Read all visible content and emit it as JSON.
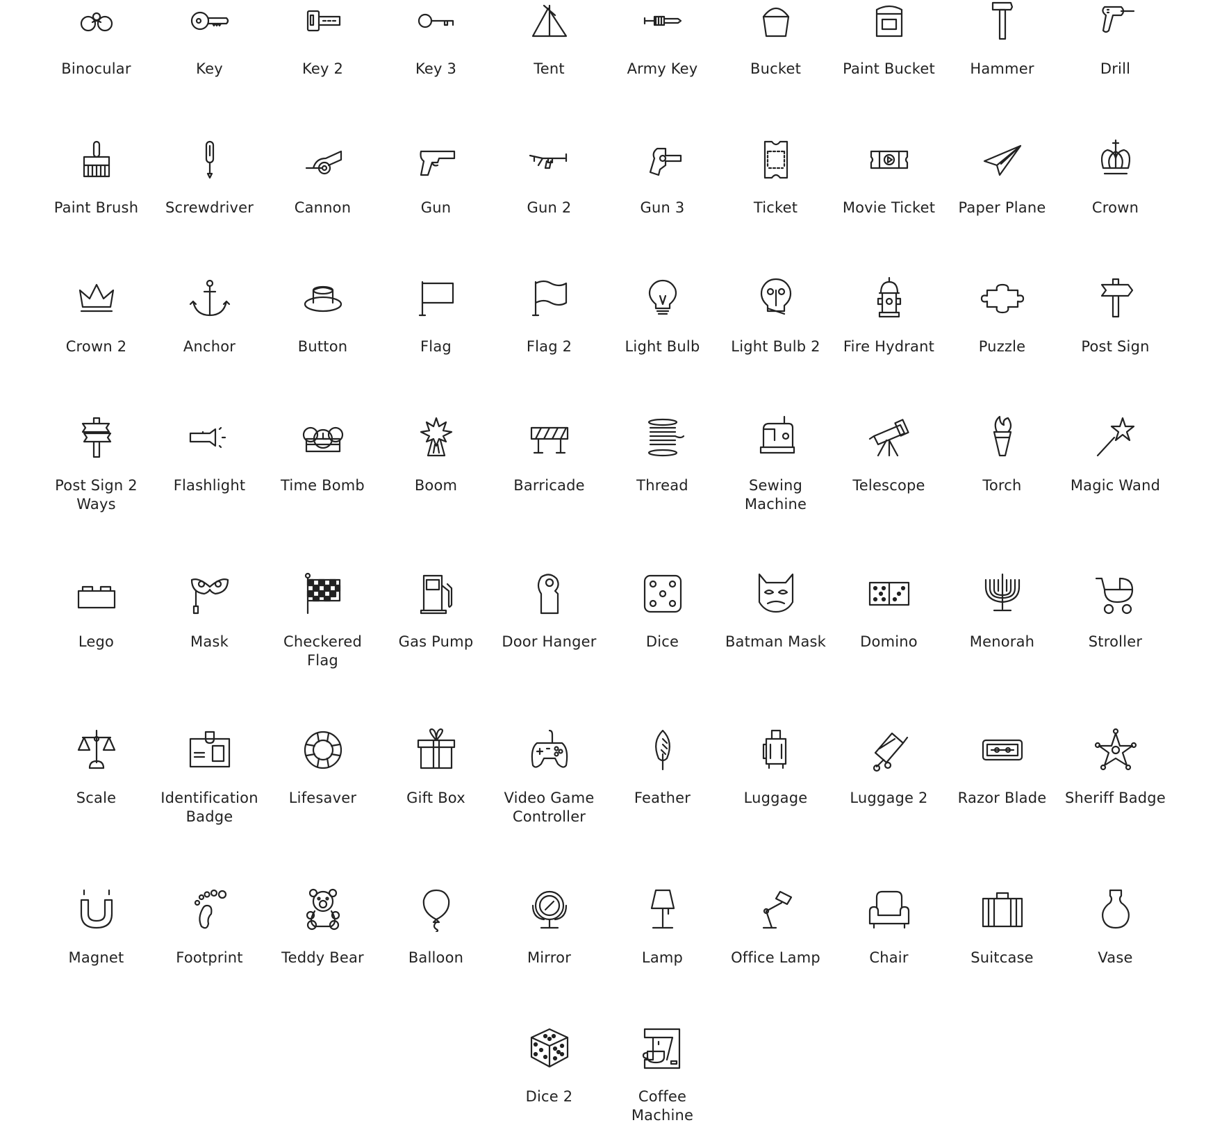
{
  "page": {
    "text_color": "#222222",
    "background": "#ffffff"
  },
  "icons": [
    {
      "name": "Binocular",
      "icon": "binocular-icon"
    },
    {
      "name": "Key",
      "icon": "key-icon"
    },
    {
      "name": "Key 2",
      "icon": "key-2-icon"
    },
    {
      "name": "Key 3",
      "icon": "key-3-icon"
    },
    {
      "name": "Tent",
      "icon": "tent-icon"
    },
    {
      "name": "Army Key",
      "icon": "army-key-icon"
    },
    {
      "name": "Bucket",
      "icon": "bucket-icon"
    },
    {
      "name": "Paint Bucket",
      "icon": "paint-bucket-icon"
    },
    {
      "name": "Hammer",
      "icon": "hammer-icon"
    },
    {
      "name": "Drill",
      "icon": "drill-icon"
    },
    {
      "name": "Paint Brush",
      "icon": "paint-brush-icon"
    },
    {
      "name": "Screwdriver",
      "icon": "screwdriver-icon"
    },
    {
      "name": "Cannon",
      "icon": "cannon-icon"
    },
    {
      "name": "Gun",
      "icon": "gun-icon"
    },
    {
      "name": "Gun 2",
      "icon": "gun-2-icon"
    },
    {
      "name": "Gun 3",
      "icon": "gun-3-icon"
    },
    {
      "name": "Ticket",
      "icon": "ticket-icon"
    },
    {
      "name": "Movie Ticket",
      "icon": "movie-ticket-icon"
    },
    {
      "name": "Paper Plane",
      "icon": "paper-plane-icon"
    },
    {
      "name": "Crown",
      "icon": "crown-icon"
    },
    {
      "name": "Crown 2",
      "icon": "crown-2-icon"
    },
    {
      "name": "Anchor",
      "icon": "anchor-icon"
    },
    {
      "name": "Button",
      "icon": "button-icon"
    },
    {
      "name": "Flag",
      "icon": "flag-icon"
    },
    {
      "name": "Flag 2",
      "icon": "flag-2-icon"
    },
    {
      "name": "Light Bulb",
      "icon": "light-bulb-icon"
    },
    {
      "name": "Light Bulb 2",
      "icon": "light-bulb-2-icon"
    },
    {
      "name": "Fire Hydrant",
      "icon": "fire-hydrant-icon"
    },
    {
      "name": "Puzzle",
      "icon": "puzzle-icon"
    },
    {
      "name": "Post Sign",
      "icon": "post-sign-icon"
    },
    {
      "name": "Post Sign 2 Ways",
      "icon": "post-sign-2-ways-icon"
    },
    {
      "name": "Flashlight",
      "icon": "flashlight-icon"
    },
    {
      "name": "Time Bomb",
      "icon": "time-bomb-icon"
    },
    {
      "name": "Boom",
      "icon": "boom-icon"
    },
    {
      "name": "Barricade",
      "icon": "barricade-icon"
    },
    {
      "name": "Thread",
      "icon": "thread-icon"
    },
    {
      "name": "Sewing Machine",
      "icon": "sewing-machine-icon"
    },
    {
      "name": "Telescope",
      "icon": "telescope-icon"
    },
    {
      "name": "Torch",
      "icon": "torch-icon"
    },
    {
      "name": "Magic Wand",
      "icon": "magic-wand-icon"
    },
    {
      "name": "Lego",
      "icon": "lego-icon"
    },
    {
      "name": "Mask",
      "icon": "mask-icon"
    },
    {
      "name": "Checkered Flag",
      "icon": "checkered-flag-icon"
    },
    {
      "name": "Gas Pump",
      "icon": "gas-pump-icon"
    },
    {
      "name": "Door Hanger",
      "icon": "door-hanger-icon"
    },
    {
      "name": "Dice",
      "icon": "dice-icon"
    },
    {
      "name": "Batman Mask",
      "icon": "batman-mask-icon"
    },
    {
      "name": "Domino",
      "icon": "domino-icon"
    },
    {
      "name": "Menorah",
      "icon": "menorah-icon"
    },
    {
      "name": "Stroller",
      "icon": "stroller-icon"
    },
    {
      "name": "Scale",
      "icon": "scale-icon"
    },
    {
      "name": "Identification Badge",
      "icon": "identification-badge-icon"
    },
    {
      "name": "Lifesaver",
      "icon": "lifesaver-icon"
    },
    {
      "name": "Gift Box",
      "icon": "gift-box-icon"
    },
    {
      "name": "Video Game Controller",
      "icon": "video-game-controller-icon"
    },
    {
      "name": "Feather",
      "icon": "feather-icon"
    },
    {
      "name": "Luggage",
      "icon": "luggage-icon"
    },
    {
      "name": "Luggage 2",
      "icon": "luggage-2-icon"
    },
    {
      "name": "Razor Blade",
      "icon": "razor-blade-icon"
    },
    {
      "name": "Sheriff Badge",
      "icon": "sheriff-badge-icon"
    },
    {
      "name": "Magnet",
      "icon": "magnet-icon"
    },
    {
      "name": "Footprint",
      "icon": "footprint-icon"
    },
    {
      "name": "Teddy Bear",
      "icon": "teddy-bear-icon"
    },
    {
      "name": "Balloon",
      "icon": "balloon-icon"
    },
    {
      "name": "Mirror",
      "icon": "mirror-icon"
    },
    {
      "name": "Lamp",
      "icon": "lamp-icon"
    },
    {
      "name": "Office Lamp",
      "icon": "office-lamp-icon"
    },
    {
      "name": "Chair",
      "icon": "chair-icon"
    },
    {
      "name": "Suitcase",
      "icon": "suitcase-icon"
    },
    {
      "name": "Vase",
      "icon": "vase-icon"
    },
    {
      "name": "Dice 2",
      "icon": "dice-2-icon"
    },
    {
      "name": "Coffee Machine",
      "icon": "coffee-machine-icon"
    }
  ]
}
